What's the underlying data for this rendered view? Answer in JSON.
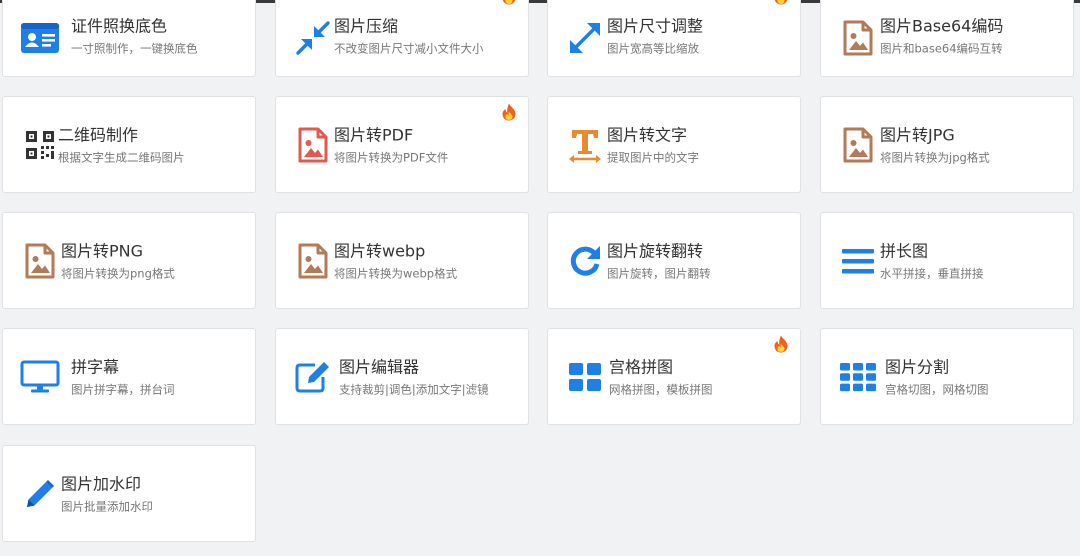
{
  "colors": {
    "blue": "#1e7fe6",
    "brown": "#b27a56",
    "red": "#e05a4f",
    "orange": "#e88b30",
    "dark": "#333333"
  },
  "tools": [
    {
      "title": "证件照换底色",
      "desc": "一寸照制作，一键换底色",
      "icon": "id-card-icon",
      "hot": false
    },
    {
      "title": "图片压缩",
      "desc": "不改变图片尺寸减小文件大小",
      "icon": "compress-arrows-icon",
      "hot": true
    },
    {
      "title": "图片尺寸调整",
      "desc": "图片宽高等比缩放",
      "icon": "expand-arrows-icon",
      "hot": true
    },
    {
      "title": "图片Base64编码",
      "desc": "图片和base64编码互转",
      "icon": "image-file-icon",
      "hot": false
    },
    {
      "title": "二维码制作",
      "desc": "根据文字生成二维码图片",
      "icon": "qrcode-icon",
      "hot": false
    },
    {
      "title": "图片转PDF",
      "desc": "将图片转换为PDF文件",
      "icon": "image-file-red-icon",
      "hot": true
    },
    {
      "title": "图片转文字",
      "desc": "提取图片中的文字",
      "icon": "text-size-icon",
      "hot": false
    },
    {
      "title": "图片转JPG",
      "desc": "将图片转换为jpg格式",
      "icon": "image-file-icon",
      "hot": false
    },
    {
      "title": "图片转PNG",
      "desc": "将图片转换为png格式",
      "icon": "image-file-icon",
      "hot": false
    },
    {
      "title": "图片转webp",
      "desc": "将图片转换为webp格式",
      "icon": "image-file-icon",
      "hot": false
    },
    {
      "title": "图片旋转翻转",
      "desc": "图片旋转，图片翻转",
      "icon": "rotate-icon",
      "hot": false
    },
    {
      "title": "拼长图",
      "desc": "水平拼接，垂直拼接",
      "icon": "bars-icon",
      "hot": false
    },
    {
      "title": "拼字幕",
      "desc": "图片拼字幕，拼台词",
      "icon": "monitor-icon",
      "hot": false
    },
    {
      "title": "图片编辑器",
      "desc": "支持裁剪|调色|添加文字|滤镜",
      "icon": "edit-icon",
      "hot": false
    },
    {
      "title": "宫格拼图",
      "desc": "网格拼图，模板拼图",
      "icon": "grid-2x2-icon",
      "hot": true
    },
    {
      "title": "图片分割",
      "desc": "宫格切图，网格切图",
      "icon": "grid-3x3-icon",
      "hot": false
    },
    {
      "title": "图片加水印",
      "desc": "图片批量添加水印",
      "icon": "pencil-icon",
      "hot": false
    }
  ]
}
